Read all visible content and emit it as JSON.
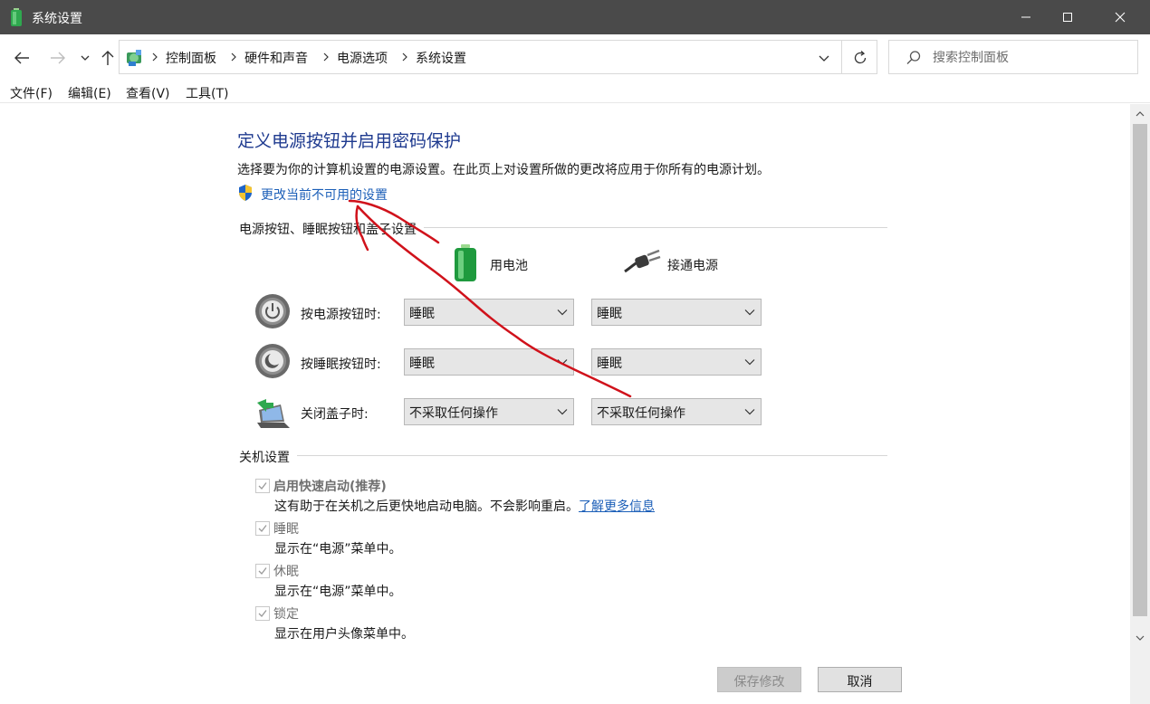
{
  "window": {
    "title": "系统设置"
  },
  "breadcrumb": [
    "控制面板",
    "硬件和声音",
    "电源选项",
    "系统设置"
  ],
  "search": {
    "placeholder": "搜索控制面板"
  },
  "menu": [
    "文件(F)",
    "编辑(E)",
    "查看(V)",
    "工具(T)"
  ],
  "page": {
    "heading": "定义电源按钮并启用密码保护",
    "description": "选择要为你的计算机设置的电源设置。在此页上对设置所做的更改将应用于你所有的电源计划。",
    "change_link": "更改当前不可用的设置"
  },
  "power_group": {
    "title": "电源按钮、睡眠按钮和盖子设置",
    "col_battery": "用电池",
    "col_plugged": "接通电源",
    "rows": [
      {
        "label": "按电源按钮时:",
        "battery": "睡眠",
        "plugged": "睡眠"
      },
      {
        "label": "按睡眠按钮时:",
        "battery": "睡眠",
        "plugged": "睡眠"
      },
      {
        "label": "关闭盖子时:",
        "battery": "不采取任何操作",
        "plugged": "不采取任何操作"
      }
    ]
  },
  "shutdown_group": {
    "title": "关机设置",
    "items": [
      {
        "label": "启用快速启动(推荐)",
        "desc": "这有助于在关机之后更快地启动电脑。不会影响重启。",
        "link": "了解更多信息",
        "checked": true,
        "bold": true
      },
      {
        "label": "睡眠",
        "desc": "显示在“电源”菜单中。",
        "checked": true,
        "bold": false
      },
      {
        "label": "休眠",
        "desc": "显示在“电源”菜单中。",
        "checked": true,
        "bold": false
      },
      {
        "label": "锁定",
        "desc": "显示在用户头像菜单中。",
        "checked": true,
        "bold": false
      }
    ]
  },
  "buttons": {
    "save": "保存修改",
    "cancel": "取消"
  },
  "colors": {
    "titlebar": "#4a4a4a",
    "heading": "#1e3a8f",
    "link": "#1c5fb8",
    "annotation": "#d0121b"
  }
}
